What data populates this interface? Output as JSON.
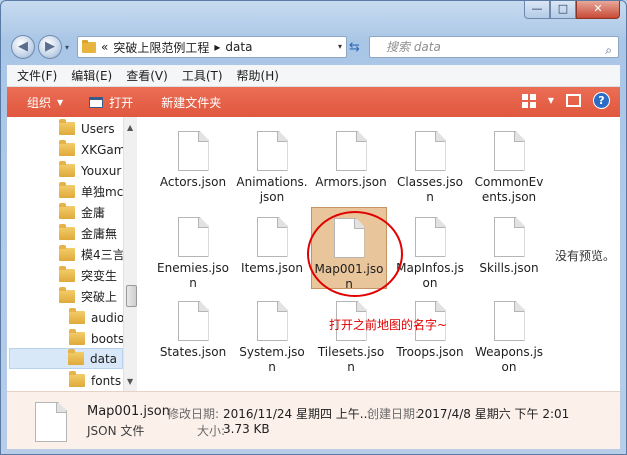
{
  "window": {
    "caption": {
      "minimize": "—",
      "maximize": "□",
      "close": "✕"
    }
  },
  "address": {
    "chevron": "«",
    "parent": "突破上限范例工程",
    "separator": "▸",
    "current": "data",
    "dropdown": "▾"
  },
  "search": {
    "placeholder": "搜索 data"
  },
  "menu": [
    "文件(F)",
    "编辑(E)",
    "查看(V)",
    "工具(T)",
    "帮助(H)"
  ],
  "toolbar": {
    "organize": "组织",
    "open": "打开",
    "new_folder": "新建文件夹",
    "accent_color": "#e55f45"
  },
  "tree": [
    {
      "label": "Users",
      "indent": 0
    },
    {
      "label": "XKGam",
      "indent": 0
    },
    {
      "label": "Youxur",
      "indent": 0
    },
    {
      "label": "单独mc",
      "indent": 0
    },
    {
      "label": "金庸",
      "indent": 0
    },
    {
      "label": "金庸無",
      "indent": 0
    },
    {
      "label": "模4三言",
      "indent": 0
    },
    {
      "label": "突变生",
      "indent": 0
    },
    {
      "label": "突破上",
      "indent": 0
    },
    {
      "label": "audio",
      "indent": 1
    },
    {
      "label": "boots",
      "indent": 1
    },
    {
      "label": "data",
      "indent": 1,
      "selected": true
    },
    {
      "label": "fonts",
      "indent": 1
    }
  ],
  "files": [
    {
      "name": "Actors.json"
    },
    {
      "name": "Animations.json"
    },
    {
      "name": "Armors.json"
    },
    {
      "name": "Classes.json"
    },
    {
      "name": "CommonEvents.json"
    },
    {
      "name": "Enemies.json"
    },
    {
      "name": "Items.json"
    },
    {
      "name": "Map001.json",
      "selected": true
    },
    {
      "name": "MapInfos.json"
    },
    {
      "name": "Skills.json"
    },
    {
      "name": "States.json"
    },
    {
      "name": "System.json"
    },
    {
      "name": "Tilesets.json"
    },
    {
      "name": "Troops.json"
    },
    {
      "name": "Weapons.json"
    }
  ],
  "preview": {
    "empty_text": "没有预览。"
  },
  "annotation": {
    "text": "打开之前地图的名字~"
  },
  "details": {
    "name": "Map001.json",
    "type": "JSON 文件",
    "modified_label": "修改日期:",
    "modified_value": "2016/11/24 星期四 上午...",
    "created_label": "创建日期:",
    "created_value": "2017/4/8 星期六 下午 2:01",
    "size_label": "大小:",
    "size_value": "3.73 KB"
  }
}
